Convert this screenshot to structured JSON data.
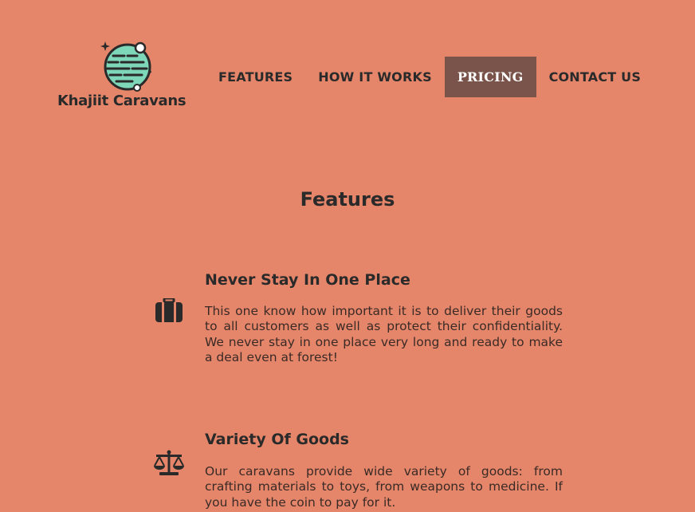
{
  "brand": {
    "name": "Khajiit Caravans",
    "planet_color": "#7dd7b8"
  },
  "nav": {
    "items": [
      {
        "label": "FEATURES"
      },
      {
        "label": "HOW IT WORKS"
      },
      {
        "label": "PRICING",
        "active": true
      },
      {
        "label": "CONTACT US"
      }
    ],
    "active_bg": "#7a544a"
  },
  "features": {
    "title": "Features",
    "items": [
      {
        "icon": "suitcase-icon",
        "title": "Never Stay In One Place",
        "text": "This one know how important it is to deliver their goods to all customers as well as protect their confidentiality. We never stay in one place very long and ready to make a deal even at forest!"
      },
      {
        "icon": "scales-icon",
        "title": "Variety Of Goods",
        "text": "Our caravans provide wide variety of goods: from crafting materials to toys, from weapons to medicine. If you have the coin to pay for it."
      }
    ]
  },
  "colors": {
    "background": "#e5866a",
    "text": "#2a2a2a"
  }
}
